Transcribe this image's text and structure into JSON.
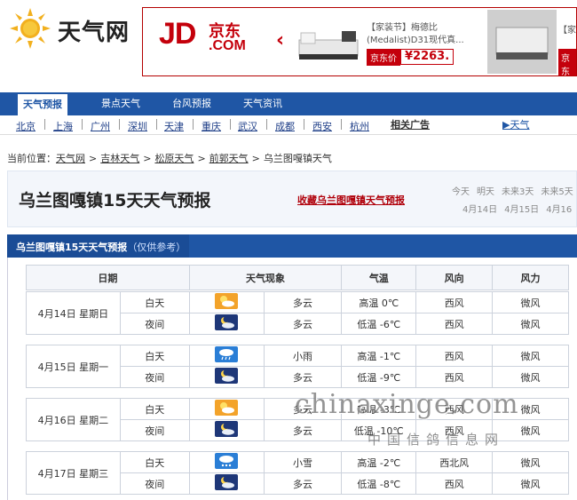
{
  "site": {
    "logo_text": "天气网"
  },
  "ad": {
    "jd_mark": "JD",
    "jd_cn": "京东",
    "jd_com": ".COM",
    "desc1": "【家装节】梅德比(Medalist)D31现代真...",
    "price_label": "京东价",
    "price_value": "¥2263.",
    "desc2": "【家",
    "price2_label": "京东"
  },
  "nav": {
    "items": [
      "天气预报",
      "景点天气",
      "台风预报",
      "天气资讯"
    ]
  },
  "cities": {
    "items": [
      "北京",
      "上海",
      "广州",
      "深圳",
      "天津",
      "重庆",
      "武汉",
      "成都",
      "西安",
      "杭州"
    ],
    "ad_label": "相关广告",
    "tianqi_link": "▶天气"
  },
  "breadcrumb": {
    "prefix": "当前位置：",
    "items": [
      "天气网",
      "吉林天气",
      "松原天气",
      "前郭天气",
      "乌兰图嘎镇天气"
    ]
  },
  "title": {
    "page_title": "乌兰图嘎镇15天天气预报",
    "favorite": "收藏乌兰图嘎镇天气预报",
    "tabs": [
      "今天",
      "明天",
      "未来3天",
      "未来5天"
    ],
    "dates": [
      "4月14日",
      "4月15日",
      "4月16"
    ]
  },
  "panel": {
    "title": "乌兰图嘎镇15天天气预报",
    "note": "（仅供参考）"
  },
  "table": {
    "headers": [
      "日期",
      "天气现象",
      "气温",
      "风向",
      "风力"
    ],
    "days": [
      {
        "date": "4月14日  星期日",
        "rows": [
          {
            "period": "白天",
            "icon": "sunny-cloudy-icon",
            "weather": "多云",
            "temp": "高温  0℃",
            "wind_dir": "西风",
            "wind_force": "微风"
          },
          {
            "period": "夜间",
            "icon": "night-cloudy-icon",
            "weather": "多云",
            "temp": "低温  -6℃",
            "wind_dir": "西风",
            "wind_force": "微风"
          }
        ]
      },
      {
        "date": "4月15日  星期一",
        "rows": [
          {
            "period": "白天",
            "icon": "light-rain-icon",
            "weather": "小雨",
            "temp": "高温  -1℃",
            "wind_dir": "西风",
            "wind_force": "微风"
          },
          {
            "period": "夜间",
            "icon": "night-cloudy-icon",
            "weather": "多云",
            "temp": "低温  -9℃",
            "wind_dir": "西风",
            "wind_force": "微风"
          }
        ]
      },
      {
        "date": "4月16日  星期二",
        "rows": [
          {
            "period": "白天",
            "icon": "sunny-cloudy-icon",
            "weather": "多云",
            "temp": "高温  -3℃",
            "wind_dir": "西风",
            "wind_force": "微风"
          },
          {
            "period": "夜间",
            "icon": "night-cloudy-icon",
            "weather": "多云",
            "temp": "低温  -10℃",
            "wind_dir": "西风",
            "wind_force": "微风"
          }
        ]
      },
      {
        "date": "4月17日  星期三",
        "rows": [
          {
            "period": "白天",
            "icon": "light-snow-icon",
            "weather": "小雪",
            "temp": "高温  -2℃",
            "wind_dir": "西北风",
            "wind_force": "微风"
          },
          {
            "period": "夜间",
            "icon": "night-cloudy-icon",
            "weather": "多云",
            "temp": "低温  -8℃",
            "wind_dir": "西风",
            "wind_force": "微风"
          }
        ]
      }
    ]
  },
  "watermark": {
    "main": "chinaxinge.com",
    "sub": "中国信鸽信息网"
  },
  "colors": {
    "nav_blue": "#1f56a5",
    "jd_red": "#c4000b"
  }
}
